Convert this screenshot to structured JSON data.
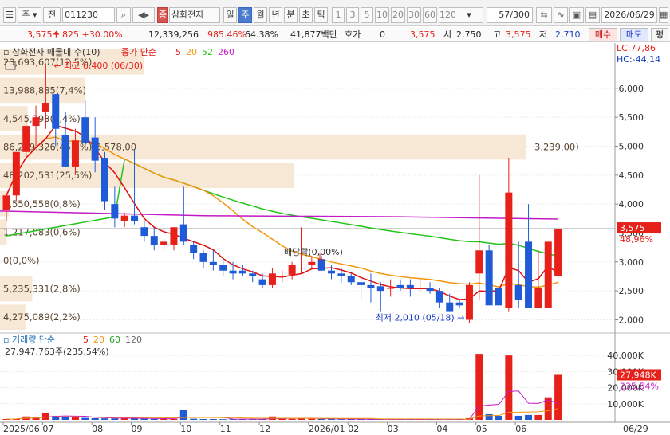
{
  "toolbar": {
    "market": "주",
    "period_selector": "전",
    "code": "011230",
    "stock_name": "삼화전자",
    "stock_icon": "종",
    "periods": [
      "일",
      "주",
      "월",
      "년",
      "분",
      "초",
      "틱"
    ],
    "active_period": "주",
    "intervals": [
      "1",
      "3",
      "5",
      "10",
      "20",
      "30",
      "60",
      "120"
    ],
    "count": "57/300",
    "date": "2026/06/29"
  },
  "quote": {
    "price": "3,575",
    "change": "825 +30.00%",
    "volume": "12,339,256",
    "volume_ratio": "985.46%",
    "turnover": "64.38%",
    "amount": "41,877백만",
    "hoga_label": "호가",
    "hoga_value": "0",
    "price2": "3,575",
    "open_label": "시",
    "open": "2,750",
    "high_label": "고",
    "high": "3,575",
    "low_label": "저",
    "low": "2,710",
    "buy_label": "매수",
    "sell_label": "매도",
    "last_button": "평"
  },
  "legend": {
    "price_title": "삼화전자 매물대 수(10)",
    "ma_title": "종가 단순",
    "ma_periods": [
      "5",
      "20",
      "52",
      "260"
    ],
    "volume_title": "거래량 단순",
    "vol_ma_periods": [
      "5",
      "20",
      "60",
      "120"
    ],
    "volume_current": "27,947,763주(235,54%)"
  },
  "chart_data": {
    "type": "candlestick",
    "x": [
      "2025/06/02",
      "2025/06/09",
      "2025/06/16",
      "2025/06/23",
      "2025/06/30",
      "2025/07/07",
      "2025/07/14",
      "2025/07/21",
      "2025/07/28",
      "2025/08/04",
      "2025/08/11",
      "2025/08/18",
      "2025/08/25",
      "2025/09/01",
      "2025/09/08",
      "2025/09/15",
      "2025/09/22",
      "2025/09/29",
      "2025/10/06",
      "2025/10/13",
      "2025/10/20",
      "2025/10/27",
      "2025/11/03",
      "2025/11/10",
      "2025/11/17",
      "2025/11/24",
      "2025/12/01",
      "2025/12/08",
      "2025/12/15",
      "2025/12/22",
      "2025/12/29",
      "2026/01/05",
      "2026/01/12",
      "2026/01/19",
      "2026/01/26",
      "2026/02/02",
      "2026/02/09",
      "2026/02/16",
      "2026/02/23",
      "2026/03/02",
      "2026/03/09",
      "2026/03/16",
      "2026/03/23",
      "2026/03/30",
      "2026/04/06",
      "2026/04/13",
      "2026/04/20",
      "2026/04/27",
      "2026/05/04",
      "2026/05/11",
      "2026/05/18",
      "2026/05/25",
      "2026/06/01",
      "2026/06/08",
      "2026/06/15",
      "2026/06/22",
      "2026/06/29"
    ],
    "open": [
      3900,
      4150,
      4900,
      5350,
      5600,
      5900,
      5200,
      4650,
      5500,
      5150,
      4800,
      4000,
      3700,
      3800,
      3600,
      3450,
      3300,
      3300,
      3650,
      3300,
      3150,
      3000,
      2950,
      2850,
      2850,
      2800,
      2700,
      2600,
      2750,
      2780,
      2900,
      2950,
      3050,
      2850,
      2800,
      2750,
      2650,
      2600,
      2580,
      2550,
      2600,
      2600,
      2550,
      2550,
      2500,
      2300,
      2300,
      2000,
      2800,
      3200,
      2550,
      2200,
      2600,
      3350,
      2200,
      2200,
      2750
    ],
    "high": [
      4150,
      4900,
      5500,
      5700,
      6400,
      5900,
      5600,
      5300,
      5800,
      5500,
      4900,
      4300,
      3850,
      4950,
      3700,
      3600,
      3400,
      3500,
      4300,
      3350,
      3200,
      3200,
      3050,
      3000,
      2950,
      2850,
      2800,
      2900,
      2850,
      3000,
      3600,
      3100,
      3100,
      2950,
      2900,
      2800,
      2750,
      2800,
      2650,
      2700,
      2700,
      2700,
      2700,
      2650,
      2550,
      2450,
      2350,
      2650,
      4500,
      3300,
      3300,
      4800,
      3350,
      4000,
      3200,
      3200,
      3600
    ],
    "low": [
      3700,
      4050,
      4800,
      5000,
      5300,
      5000,
      4650,
      4500,
      5000,
      4550,
      3900,
      3600,
      3600,
      3650,
      3350,
      3200,
      3200,
      3200,
      3300,
      3050,
      2900,
      2850,
      2750,
      2700,
      2750,
      2650,
      2550,
      2550,
      2650,
      2700,
      2800,
      2900,
      2850,
      2700,
      2650,
      2600,
      2350,
      2300,
      2150,
      2400,
      2500,
      2400,
      2500,
      2450,
      2200,
      2150,
      2200,
      1950,
      2350,
      2650,
      2050,
      2150,
      2200,
      2600,
      2300,
      2400,
      2600
    ],
    "close": [
      4150,
      4900,
      5350,
      5500,
      5750,
      5300,
      4650,
      5100,
      5050,
      4750,
      4050,
      3750,
      3800,
      3700,
      3450,
      3300,
      3350,
      3600,
      3350,
      3150,
      3000,
      2950,
      2850,
      2800,
      2800,
      2750,
      2600,
      2800,
      2750,
      2950,
      2900,
      3000,
      2850,
      2800,
      2750,
      2650,
      2600,
      2550,
      2500,
      2550,
      2550,
      2550,
      2550,
      2500,
      2300,
      2150,
      2250,
      2600,
      3200,
      2250,
      2250,
      4200,
      2350,
      2200,
      2550,
      3350,
      3575
    ],
    "volume": [
      500000,
      600000,
      2100000,
      1500000,
      4000000,
      2500000,
      1900000,
      1500000,
      1200000,
      1000000,
      900000,
      900000,
      800000,
      1200000,
      700000,
      600000,
      500000,
      500000,
      6000000,
      700000,
      500000,
      500000,
      400000,
      400000,
      400000,
      350000,
      350000,
      2100000,
      800000,
      600000,
      900000,
      700000,
      500000,
      600000,
      400000,
      350000,
      300000,
      300000,
      300000,
      350000,
      300000,
      300000,
      400000,
      300000,
      300000,
      300000,
      250000,
      1000000,
      41000000,
      3500000,
      2500000,
      40000000,
      2500000,
      3000000,
      3000000,
      14000000,
      27947763
    ],
    "yrange": [
      1800,
      6700
    ],
    "yticks": [
      "6,000",
      "5,500",
      "5,000",
      "4,500",
      "4,000",
      "3,500",
      "3,000",
      "2,500",
      "2,000"
    ],
    "vol_ticks": [
      "40,000K",
      "30,000K",
      "20,000K",
      "10,000K"
    ],
    "xtick_labels": [
      "2025/06",
      "07",
      "08",
      "09",
      "10",
      "11",
      "12",
      "2026/01",
      "02",
      "03",
      "04",
      "05",
      "06",
      "06/29"
    ],
    "volume_profile": [
      {
        "label": "4,275,089(2,2%)",
        "pct": 2.2
      },
      {
        "label": "5,235,331(2,8%)",
        "pct": 2.8
      },
      {
        "label": "0(0,0%)",
        "pct": 0.0
      },
      {
        "label": "1,217,083(0,6%)",
        "pct": 0.6
      },
      {
        "label": "1,550,558(0,8%)",
        "pct": 0.8
      },
      {
        "label": "48,202,531(25,5%)",
        "pct": 25.5
      },
      {
        "label": "86,279,326(45,7%)(3,578,00",
        "pct": 45.7
      },
      {
        "label": "4,545,393(2,4%)",
        "pct": 2.4
      },
      {
        "label": "13,988,885(7,4%)",
        "pct": 7.4
      },
      {
        "label": "23,693,607(12,5%)",
        "pct": 12.5
      }
    ],
    "overlap_label": "3,239,00)",
    "annotations": {
      "max": "최고 6,400 (06/30)",
      "min": "최저 2,010 (05/18)",
      "dividend": "배당락(0,00%)",
      "lc": "LC:77,86",
      "hc": "HC:-44,14",
      "last_price": "3,575",
      "last_change": "48,96%",
      "last_volume": "27,948K",
      "last_vol_ratio": "235,54%"
    },
    "colors": {
      "up": "#e8201a",
      "down": "#1f5bd6",
      "ma5": "#e01010",
      "ma20": "#f2960c",
      "ma52": "#22c41a",
      "ma260": "#c41ac4"
    }
  }
}
